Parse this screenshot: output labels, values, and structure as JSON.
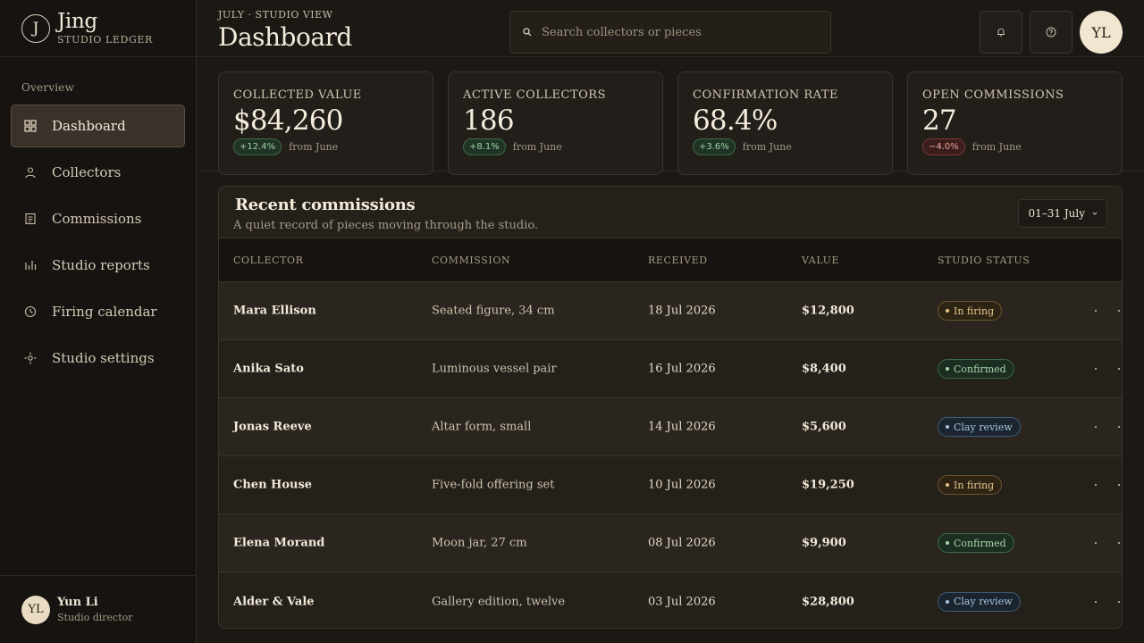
{
  "brand": {
    "mark": "J",
    "name": "Jing",
    "sub": "STUDIO LEDGER"
  },
  "sidebar": {
    "section": "Overview",
    "items": [
      {
        "label": "Dashboard",
        "icon": "grid-icon",
        "active": true
      },
      {
        "label": "Collectors",
        "icon": "person-icon"
      },
      {
        "label": "Commissions",
        "icon": "document-icon"
      },
      {
        "label": "Studio reports",
        "icon": "bar-chart-icon"
      },
      {
        "label": "Firing calendar",
        "icon": "clock-icon"
      },
      {
        "label": "Studio settings",
        "icon": "gear-icon"
      }
    ],
    "user": {
      "initials": "YL",
      "name": "Yun Li",
      "role": "Studio director"
    }
  },
  "header": {
    "eyebrow": "JULY · STUDIO VIEW",
    "title": "Dashboard",
    "search_placeholder": "Search collectors or pieces",
    "avatar": "YL"
  },
  "stats": [
    {
      "label": "COLLECTED VALUE",
      "value": "$84,260",
      "delta": "+12.4%",
      "direction": "up",
      "period": "from June"
    },
    {
      "label": "ACTIVE COLLECTORS",
      "value": "186",
      "delta": "+8.1%",
      "direction": "up",
      "period": "from June"
    },
    {
      "label": "CONFIRMATION RATE",
      "value": "68.4%",
      "delta": "+3.6%",
      "direction": "up",
      "period": "from June"
    },
    {
      "label": "OPEN COMMISSIONS",
      "value": "27",
      "delta": "−4.0%",
      "direction": "down",
      "period": "from June"
    }
  ],
  "table": {
    "title": "Recent commissions",
    "subtitle": "A quiet record of pieces moving through the studio.",
    "range": "01–31 July",
    "columns": [
      "COLLECTOR",
      "COMMISSION",
      "RECEIVED",
      "VALUE",
      "STUDIO STATUS"
    ],
    "rows": [
      {
        "collector": "Mara Ellison",
        "commission": "Seated figure, 34 cm",
        "received": "18 Jul 2026",
        "value": "$12,800",
        "status": "In firing",
        "status_kind": "firing"
      },
      {
        "collector": "Anika Sato",
        "commission": "Luminous vessel pair",
        "received": "16 Jul 2026",
        "value": "$8,400",
        "status": "Confirmed",
        "status_kind": "confirmed"
      },
      {
        "collector": "Jonas Reeve",
        "commission": "Altar form, small",
        "received": "14 Jul 2026",
        "value": "$5,600",
        "status": "Clay review",
        "status_kind": "review"
      },
      {
        "collector": "Chen House",
        "commission": "Five-fold offering set",
        "received": "10 Jul 2026",
        "value": "$19,250",
        "status": "In firing",
        "status_kind": "firing"
      },
      {
        "collector": "Elena Morand",
        "commission": "Moon jar, 27 cm",
        "received": "08 Jul 2026",
        "value": "$9,900",
        "status": "Confirmed",
        "status_kind": "confirmed"
      },
      {
        "collector": "Alder & Vale",
        "commission": "Gallery edition, twelve",
        "received": "03 Jul 2026",
        "value": "$28,800",
        "status": "Clay review",
        "status_kind": "review"
      }
    ]
  }
}
